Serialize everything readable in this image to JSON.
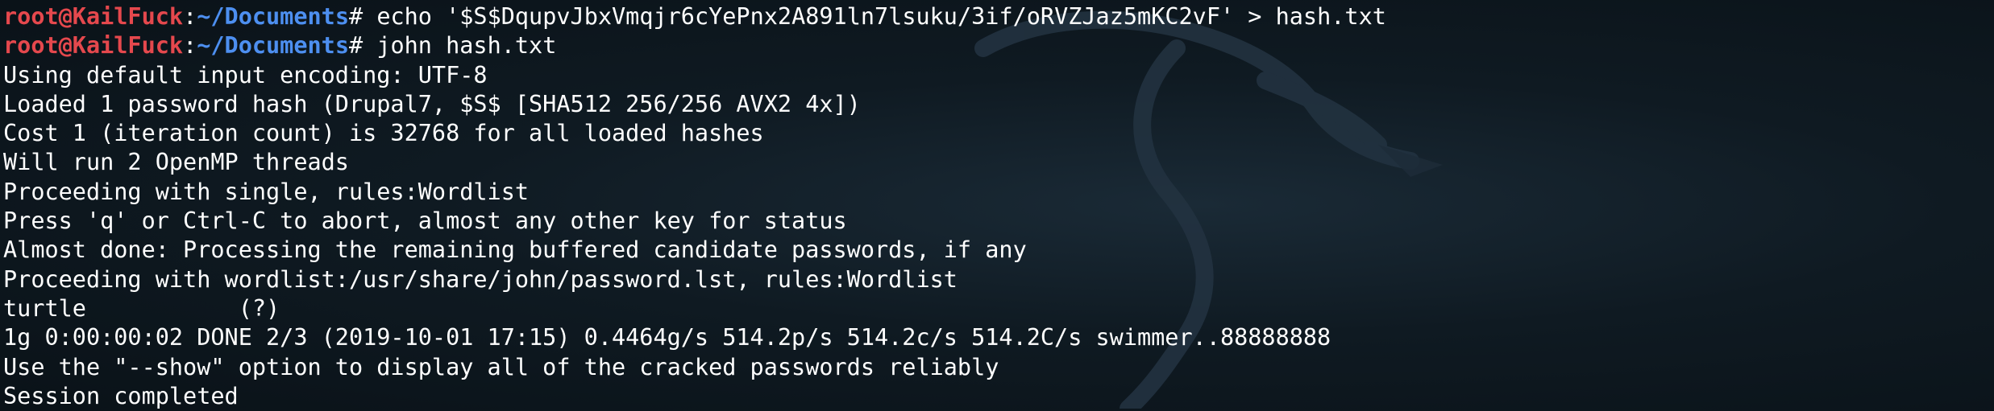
{
  "terminal": {
    "prompt_user": "root@KailFuck",
    "prompt_colon": ":",
    "prompt_path": "~/Documents",
    "prompt_symbol": "#",
    "commands": [
      " echo '$S$DqupvJbxVmqjr6cYePnx2A891ln7lsuku/3if/oRVZJaz5mKC2vF' > hash.txt",
      " john hash.txt"
    ],
    "output_lines": [
      "Using default input encoding: UTF-8",
      "Loaded 1 password hash (Drupal7, $S$ [SHA512 256/256 AVX2 4x])",
      "Cost 1 (iteration count) is 32768 for all loaded hashes",
      "Will run 2 OpenMP threads",
      "Proceeding with single, rules:Wordlist",
      "Press 'q' or Ctrl-C to abort, almost any other key for status",
      "Almost done: Processing the remaining buffered candidate passwords, if any",
      "Proceeding with wordlist:/usr/share/john/password.lst, rules:Wordlist",
      "turtle           (?)",
      "1g 0:00:00:02 DONE 2/3 (2019-10-01 17:15) 0.4464g/s 514.2p/s 514.2c/s 514.2C/s swimmer..88888888",
      "Use the \"--show\" option to display all of the cracked passwords reliably",
      "Session completed"
    ]
  },
  "background": {
    "watermark_icon": "kali-dragon-icon",
    "color": "#0f1a22"
  }
}
